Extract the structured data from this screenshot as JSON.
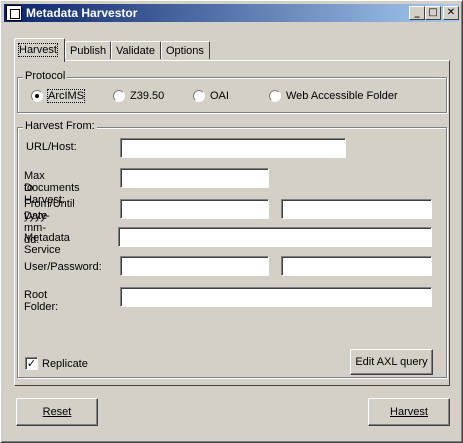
{
  "window": {
    "title": "Metadata Harvestor",
    "min": "_",
    "max": "□",
    "close": "✕"
  },
  "tabs": [
    {
      "label": "Harvest"
    },
    {
      "label": "Publish"
    },
    {
      "label": "Validate"
    },
    {
      "label": "Options"
    }
  ],
  "protocol": {
    "legend": "Protocol",
    "options": [
      "ArcIMS",
      "Z39.50",
      "OAI",
      "Web Accessible Folder"
    ],
    "selected": "ArcIMS"
  },
  "harvest_from": {
    "legend": "Harvest From:",
    "url_label": "URL/Host:",
    "url_value": "",
    "max_docs_label_1": "Max Documents",
    "max_docs_label_2": "to Harvest:",
    "max_docs_value": "",
    "date_label_1": "From/Until Date",
    "date_label_2": "yyyy-mm-dd:",
    "from_date_value": "",
    "until_date_value": "",
    "metadata_service_label": "Metadata Service",
    "metadata_service_value": "",
    "user_password_label": "User/Password:",
    "user_value": "",
    "password_value": "",
    "root_folder_label": "Root Folder:",
    "root_folder_value": "",
    "replicate_label": "Replicate",
    "replicate_checked": true,
    "edit_axl_label": "Edit AXL query"
  },
  "footer": {
    "reset_label": "Reset",
    "harvest_label": "Harvest"
  }
}
